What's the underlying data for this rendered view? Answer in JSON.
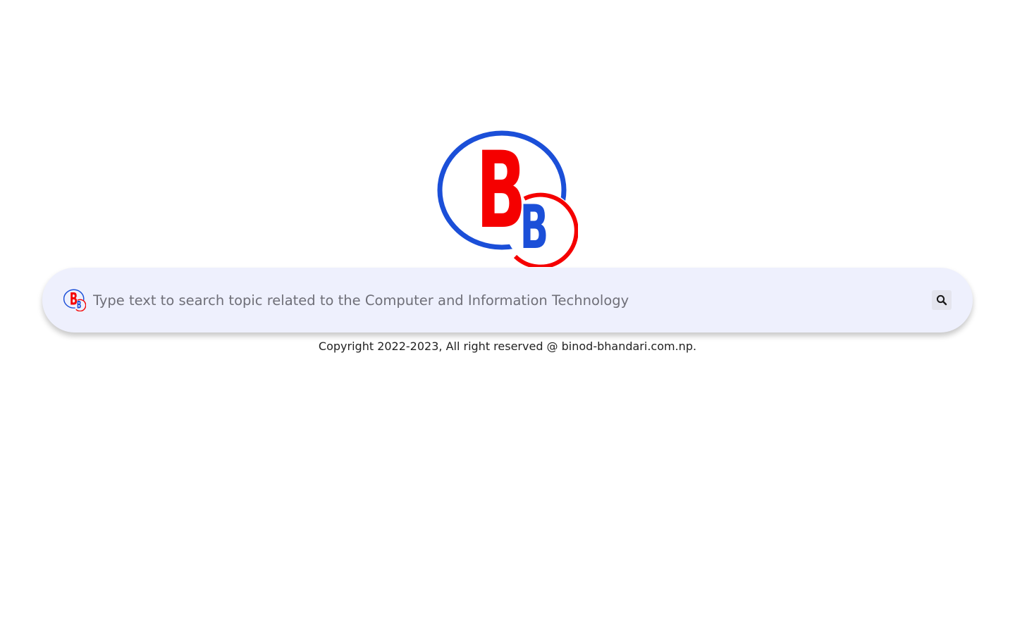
{
  "logo": {
    "big_letter": "B",
    "small_letter": "B",
    "primary_color": "#1b4fd8",
    "accent_color": "#f50000"
  },
  "search": {
    "placeholder": "Type text to search topic related to the Computer and Information Technology",
    "value": "",
    "icon": "search-icon"
  },
  "footer": {
    "copyright": "Copyright 2022-2023, All right reserved @ binod-bhandari.com.np."
  },
  "colors": {
    "search_bar_bg": "#eef0fd",
    "page_bg": "#ffffff"
  }
}
